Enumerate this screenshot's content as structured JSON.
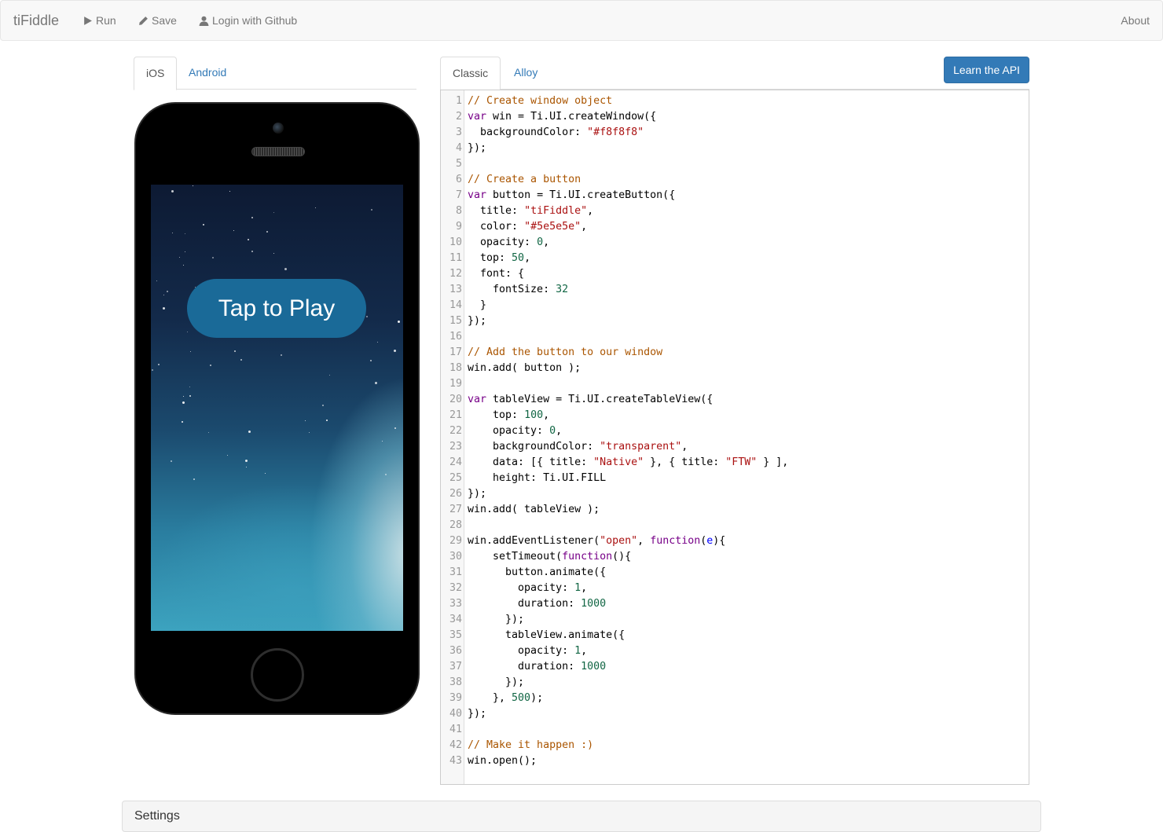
{
  "navbar": {
    "brand": "tiFiddle",
    "run_label": "Run",
    "save_label": "Save",
    "login_label": "Login with Github",
    "about_label": "About"
  },
  "device_tabs": [
    {
      "label": "iOS",
      "active": true
    },
    {
      "label": "Android",
      "active": false
    }
  ],
  "editor_tabs": [
    {
      "label": "Classic",
      "active": true
    },
    {
      "label": "Alloy",
      "active": false
    }
  ],
  "learn_api_label": "Learn the API",
  "simulator": {
    "button_label": "Tap to Play"
  },
  "code_lines": [
    [
      [
        "cm",
        "// Create window object"
      ]
    ],
    [
      [
        "kw",
        "var"
      ],
      [
        "pl",
        " win = Ti.UI.createWindow({"
      ]
    ],
    [
      [
        "pl",
        "  backgroundColor: "
      ],
      [
        "str",
        "\"#f8f8f8\""
      ]
    ],
    [
      [
        "pl",
        "});"
      ]
    ],
    [],
    [
      [
        "cm",
        "// Create a button"
      ]
    ],
    [
      [
        "kw",
        "var"
      ],
      [
        "pl",
        " button = Ti.UI.createButton({"
      ]
    ],
    [
      [
        "pl",
        "  title: "
      ],
      [
        "str",
        "\"tiFiddle\""
      ],
      [
        "pl",
        ","
      ]
    ],
    [
      [
        "pl",
        "  color: "
      ],
      [
        "str",
        "\"#5e5e5e\""
      ],
      [
        "pl",
        ","
      ]
    ],
    [
      [
        "pl",
        "  opacity: "
      ],
      [
        "num",
        "0"
      ],
      [
        "pl",
        ","
      ]
    ],
    [
      [
        "pl",
        "  top: "
      ],
      [
        "num",
        "50"
      ],
      [
        "pl",
        ","
      ]
    ],
    [
      [
        "pl",
        "  font: {"
      ]
    ],
    [
      [
        "pl",
        "    fontSize: "
      ],
      [
        "num",
        "32"
      ]
    ],
    [
      [
        "pl",
        "  }"
      ]
    ],
    [
      [
        "pl",
        "});"
      ]
    ],
    [],
    [
      [
        "cm",
        "// Add the button to our window"
      ]
    ],
    [
      [
        "pl",
        "win.add( button );"
      ]
    ],
    [],
    [
      [
        "kw",
        "var"
      ],
      [
        "pl",
        " tableView = Ti.UI.createTableView({"
      ]
    ],
    [
      [
        "pl",
        "    top: "
      ],
      [
        "num",
        "100"
      ],
      [
        "pl",
        ","
      ]
    ],
    [
      [
        "pl",
        "    opacity: "
      ],
      [
        "num",
        "0"
      ],
      [
        "pl",
        ","
      ]
    ],
    [
      [
        "pl",
        "    backgroundColor: "
      ],
      [
        "str",
        "\"transparent\""
      ],
      [
        "pl",
        ","
      ]
    ],
    [
      [
        "pl",
        "    data: [{ title: "
      ],
      [
        "str",
        "\"Native\""
      ],
      [
        "pl",
        " }, { title: "
      ],
      [
        "str",
        "\"FTW\""
      ],
      [
        "pl",
        " } ],"
      ]
    ],
    [
      [
        "pl",
        "    height: Ti.UI.FILL"
      ]
    ],
    [
      [
        "pl",
        "});"
      ]
    ],
    [
      [
        "pl",
        "win.add( tableView );"
      ]
    ],
    [],
    [
      [
        "pl",
        "win.addEventListener("
      ],
      [
        "str",
        "\"open\""
      ],
      [
        "pl",
        ", "
      ],
      [
        "kw",
        "function"
      ],
      [
        "pl",
        "("
      ],
      [
        "def",
        "e"
      ],
      [
        "pl",
        "){"
      ]
    ],
    [
      [
        "pl",
        "    setTimeout("
      ],
      [
        "kw",
        "function"
      ],
      [
        "pl",
        "(){"
      ]
    ],
    [
      [
        "pl",
        "      button.animate({"
      ]
    ],
    [
      [
        "pl",
        "        opacity: "
      ],
      [
        "num",
        "1"
      ],
      [
        "pl",
        ","
      ]
    ],
    [
      [
        "pl",
        "        duration: "
      ],
      [
        "num",
        "1000"
      ]
    ],
    [
      [
        "pl",
        "      });"
      ]
    ],
    [
      [
        "pl",
        "      tableView.animate({"
      ]
    ],
    [
      [
        "pl",
        "        opacity: "
      ],
      [
        "num",
        "1"
      ],
      [
        "pl",
        ","
      ]
    ],
    [
      [
        "pl",
        "        duration: "
      ],
      [
        "num",
        "1000"
      ]
    ],
    [
      [
        "pl",
        "      });"
      ]
    ],
    [
      [
        "pl",
        "    }, "
      ],
      [
        "num",
        "500"
      ],
      [
        "pl",
        ");"
      ]
    ],
    [
      [
        "pl",
        "});"
      ]
    ],
    [],
    [
      [
        "cm",
        "// Make it happen :)"
      ]
    ],
    [
      [
        "pl",
        "win.open();"
      ]
    ]
  ],
  "settings_title": "Settings",
  "icons": {
    "run": "play-icon",
    "save": "pencil-icon",
    "login": "user-icon"
  },
  "colors": {
    "primary": "#337ab7",
    "navbar_bg": "#f8f8f8",
    "link": "#337ab7",
    "play_button": "#1a6a98"
  }
}
